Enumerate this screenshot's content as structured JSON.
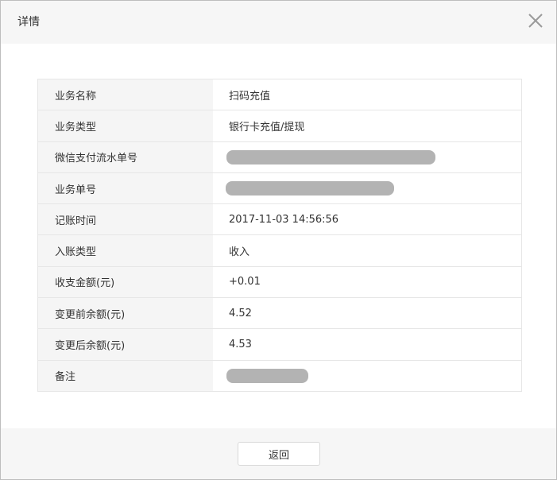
{
  "dialog": {
    "title": "详情",
    "close_icon": "close-icon"
  },
  "details": [
    {
      "label": "业务名称",
      "value": "扫码充值"
    },
    {
      "label": "业务类型",
      "value": "银行卡充值/提现"
    },
    {
      "label": "微信支付流水单号",
      "value": "",
      "redacted": true
    },
    {
      "label": "业务单号",
      "value": "",
      "redacted": true
    },
    {
      "label": "记账时间",
      "value": "2017-11-03 14:56:56"
    },
    {
      "label": "入账类型",
      "value": "收入"
    },
    {
      "label": "收支金额(元)",
      "value": "+0.01",
      "color": "#44b549"
    },
    {
      "label": "变更前余额(元)",
      "value": "4.52"
    },
    {
      "label": "变更后余额(元)",
      "value": "4.53"
    },
    {
      "label": "备注",
      "value": "",
      "redacted": true
    }
  ],
  "footer": {
    "back_label": "返回"
  }
}
